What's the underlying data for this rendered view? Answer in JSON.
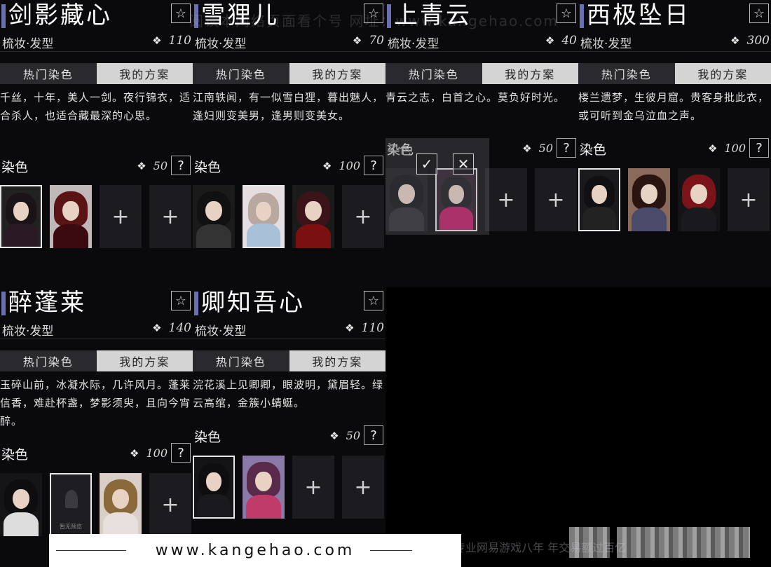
{
  "watermark": "阅读本网络页面看个号  网址：www.kangehao.com",
  "footer": {
    "site": "www.kangehao.com",
    "slogan": "看个号专业网易游戏八年  年交易额过百亿"
  },
  "cards": [
    {
      "title": "剑影藏心",
      "category": "梳妆·发型",
      "price": "110",
      "tab_hot": "热门染色",
      "tab_mine": "我的方案",
      "desc": "千丝，十年，美人一剑。夜行锦衣，适合杀人，也适合藏最深的心思。",
      "dye_label": "染色",
      "dye_price": "50",
      "slots": [
        {
          "type": "portrait",
          "selected": true,
          "hair": "#1a1418",
          "body": "#2a1a24",
          "bg": "#222"
        },
        {
          "type": "portrait",
          "selected": false,
          "hair": "#5a1414",
          "body": "#3a0a10",
          "bg": "#c0b8b8"
        },
        {
          "type": "empty"
        },
        {
          "type": "empty"
        }
      ]
    },
    {
      "title": "雪狸儿",
      "category": "梳妆·发型",
      "price": "70",
      "tab_hot": "热门染色",
      "tab_mine": "我的方案",
      "desc": "江南轶闻，有一似雪白狸，暮出魅人，逢妇则变美男，逢男则变美女。",
      "dye_label": "染色",
      "dye_price": "100",
      "slots": [
        {
          "type": "portrait",
          "selected": false,
          "hair": "#111",
          "body": "#333",
          "bg": "#1a1a1a"
        },
        {
          "type": "portrait",
          "selected": true,
          "hair": "#b8a8a0",
          "body": "#a8c0d8",
          "bg": "#e4dee0"
        },
        {
          "type": "portrait",
          "selected": false,
          "hair": "#3a1418",
          "body": "#7a1010",
          "bg": "#1a1a1a"
        },
        {
          "type": "empty"
        }
      ]
    },
    {
      "title": "上青云",
      "category": "梳妆·发型",
      "price": "40",
      "tab_hot": "热门染色",
      "tab_mine": "我的方案",
      "desc": "青云之志，白首之心。莫负好时光。",
      "dye_label": "染色",
      "dye_price": "50",
      "slots": [
        {
          "type": "portrait",
          "selected": false,
          "hair": "#0e0e10",
          "body": "#2a2a2e",
          "bg": "#151518"
        },
        {
          "type": "portrait",
          "selected": true,
          "hair": "#151518",
          "body": "#c01860",
          "bg": "#2a1a28"
        },
        {
          "type": "empty"
        },
        {
          "type": "empty"
        }
      ]
    },
    {
      "title": "西极坠日",
      "category": "梳妆·发型",
      "price": "300",
      "tab_hot": "热门染色",
      "tab_mine": "我的方案",
      "desc": "楼兰遗梦，生彼月窟。贵客身批此衣，或可听到金乌泣血之声。",
      "dye_label": "染色",
      "dye_price": "100",
      "slots": [
        {
          "type": "portrait",
          "selected": true,
          "hair": "#101012",
          "body": "#222",
          "bg": "#1a1a1c"
        },
        {
          "type": "portrait",
          "selected": false,
          "hair": "#2a1410",
          "body": "#4a4a6a",
          "bg": "#8a6a5a"
        },
        {
          "type": "portrait",
          "selected": false,
          "hair": "#7a1418",
          "body": "#1a1a1e",
          "bg": "#141416"
        },
        {
          "type": "empty"
        }
      ]
    },
    {
      "title": "醉蓬莱",
      "category": "梳妆·发型",
      "price": "140",
      "tab_hot": "热门染色",
      "tab_mine": "我的方案",
      "desc": "玉碎山前，冰凝水际，几许风月。蓬莱信香，难赴杯盏，梦影须臾，且向今宵醉。",
      "dye_label": "染色",
      "dye_price": "100",
      "slots": [
        {
          "type": "portrait",
          "selected": false,
          "hair": "#0e0e10",
          "body": "#ddd",
          "bg": "#151518"
        },
        {
          "type": "placeholder",
          "selected": true,
          "caption": "暂无预览"
        },
        {
          "type": "portrait",
          "selected": false,
          "hair": "#8a6a3a",
          "body": "#e8e0dc",
          "bg": "#d8d0c8"
        },
        {
          "type": "empty"
        }
      ]
    },
    {
      "title": "卿知吾心",
      "category": "梳妆·发型",
      "price": "110",
      "tab_hot": "热门染色",
      "tab_mine": "我的方案",
      "desc": "浣花溪上见卿卿，眼波明，黛眉轻。绿云高绾，金簇小蜻蜓。",
      "dye_label": "染色",
      "dye_price": "50",
      "slots": [
        {
          "type": "portrait",
          "selected": true,
          "hair": "#0e0e10",
          "body": "#1a1a1e",
          "bg": "#141416"
        },
        {
          "type": "portrait",
          "selected": false,
          "hair": "#5a2a4a",
          "body": "#c03a6a",
          "bg": "#8a7aa8"
        },
        {
          "type": "empty"
        },
        {
          "type": "empty"
        }
      ]
    }
  ],
  "overlay": {
    "label": "染色",
    "confirm_icon": "check-icon",
    "cancel_icon": "close-icon"
  },
  "icons": {
    "star": "☆",
    "help": "?",
    "plus": "+",
    "coin": "❖",
    "check": "✓",
    "close": "✕"
  }
}
